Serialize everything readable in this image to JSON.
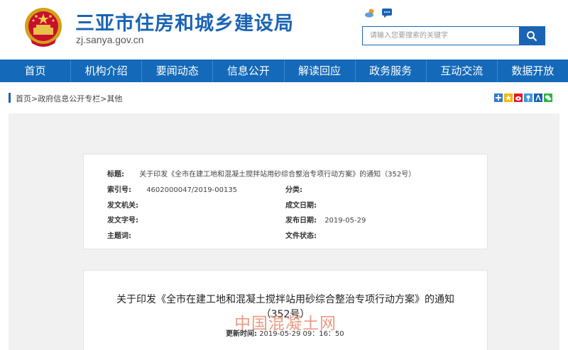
{
  "site": {
    "title": "三亚市住房和城乡建设局",
    "domain": "zj.sanya.gov.cn"
  },
  "search": {
    "placeholder": "请输入您要搜索的关键字"
  },
  "nav": [
    "首页",
    "机构介绍",
    "要闻动态",
    "信息公开",
    "解读回应",
    "政务服务",
    "互动交流",
    "数据开放"
  ],
  "breadcrumb": {
    "home": "首页",
    "sep1": ">",
    "section": "政府信息公开专栏",
    "sep2": ">",
    "current": "其他"
  },
  "meta": {
    "title_label": "标题:",
    "title_value": "关于印发《全市在建工地和混凝土搅拌站用砂综合整治专项行动方案》的通知（352号）",
    "index_label": "索引号:",
    "index_value": "4602000047/2019-00135",
    "category_label": "分类:",
    "category_value": "",
    "issuer_label": "发文机关:",
    "issuer_value": "",
    "created_label": "成文日期:",
    "created_value": "",
    "docno_label": "发文字号:",
    "docno_value": "",
    "published_label": "发布日期:",
    "published_value": "2019-05-29",
    "subject_label": "主题词:",
    "subject_value": "",
    "status_label": "文件状态:",
    "status_value": ""
  },
  "article": {
    "title": "关于印发《全市在建工地和混凝土搅拌站用砂综合整治专项行动方案》的通知（352号）",
    "update_label": "更新时间:",
    "update_value": "2019-05-29 09：16：50",
    "watermark": "中国混凝土网"
  },
  "colors": {
    "brand_blue": "#1a64b4",
    "nav_blue": "#1469b8"
  }
}
